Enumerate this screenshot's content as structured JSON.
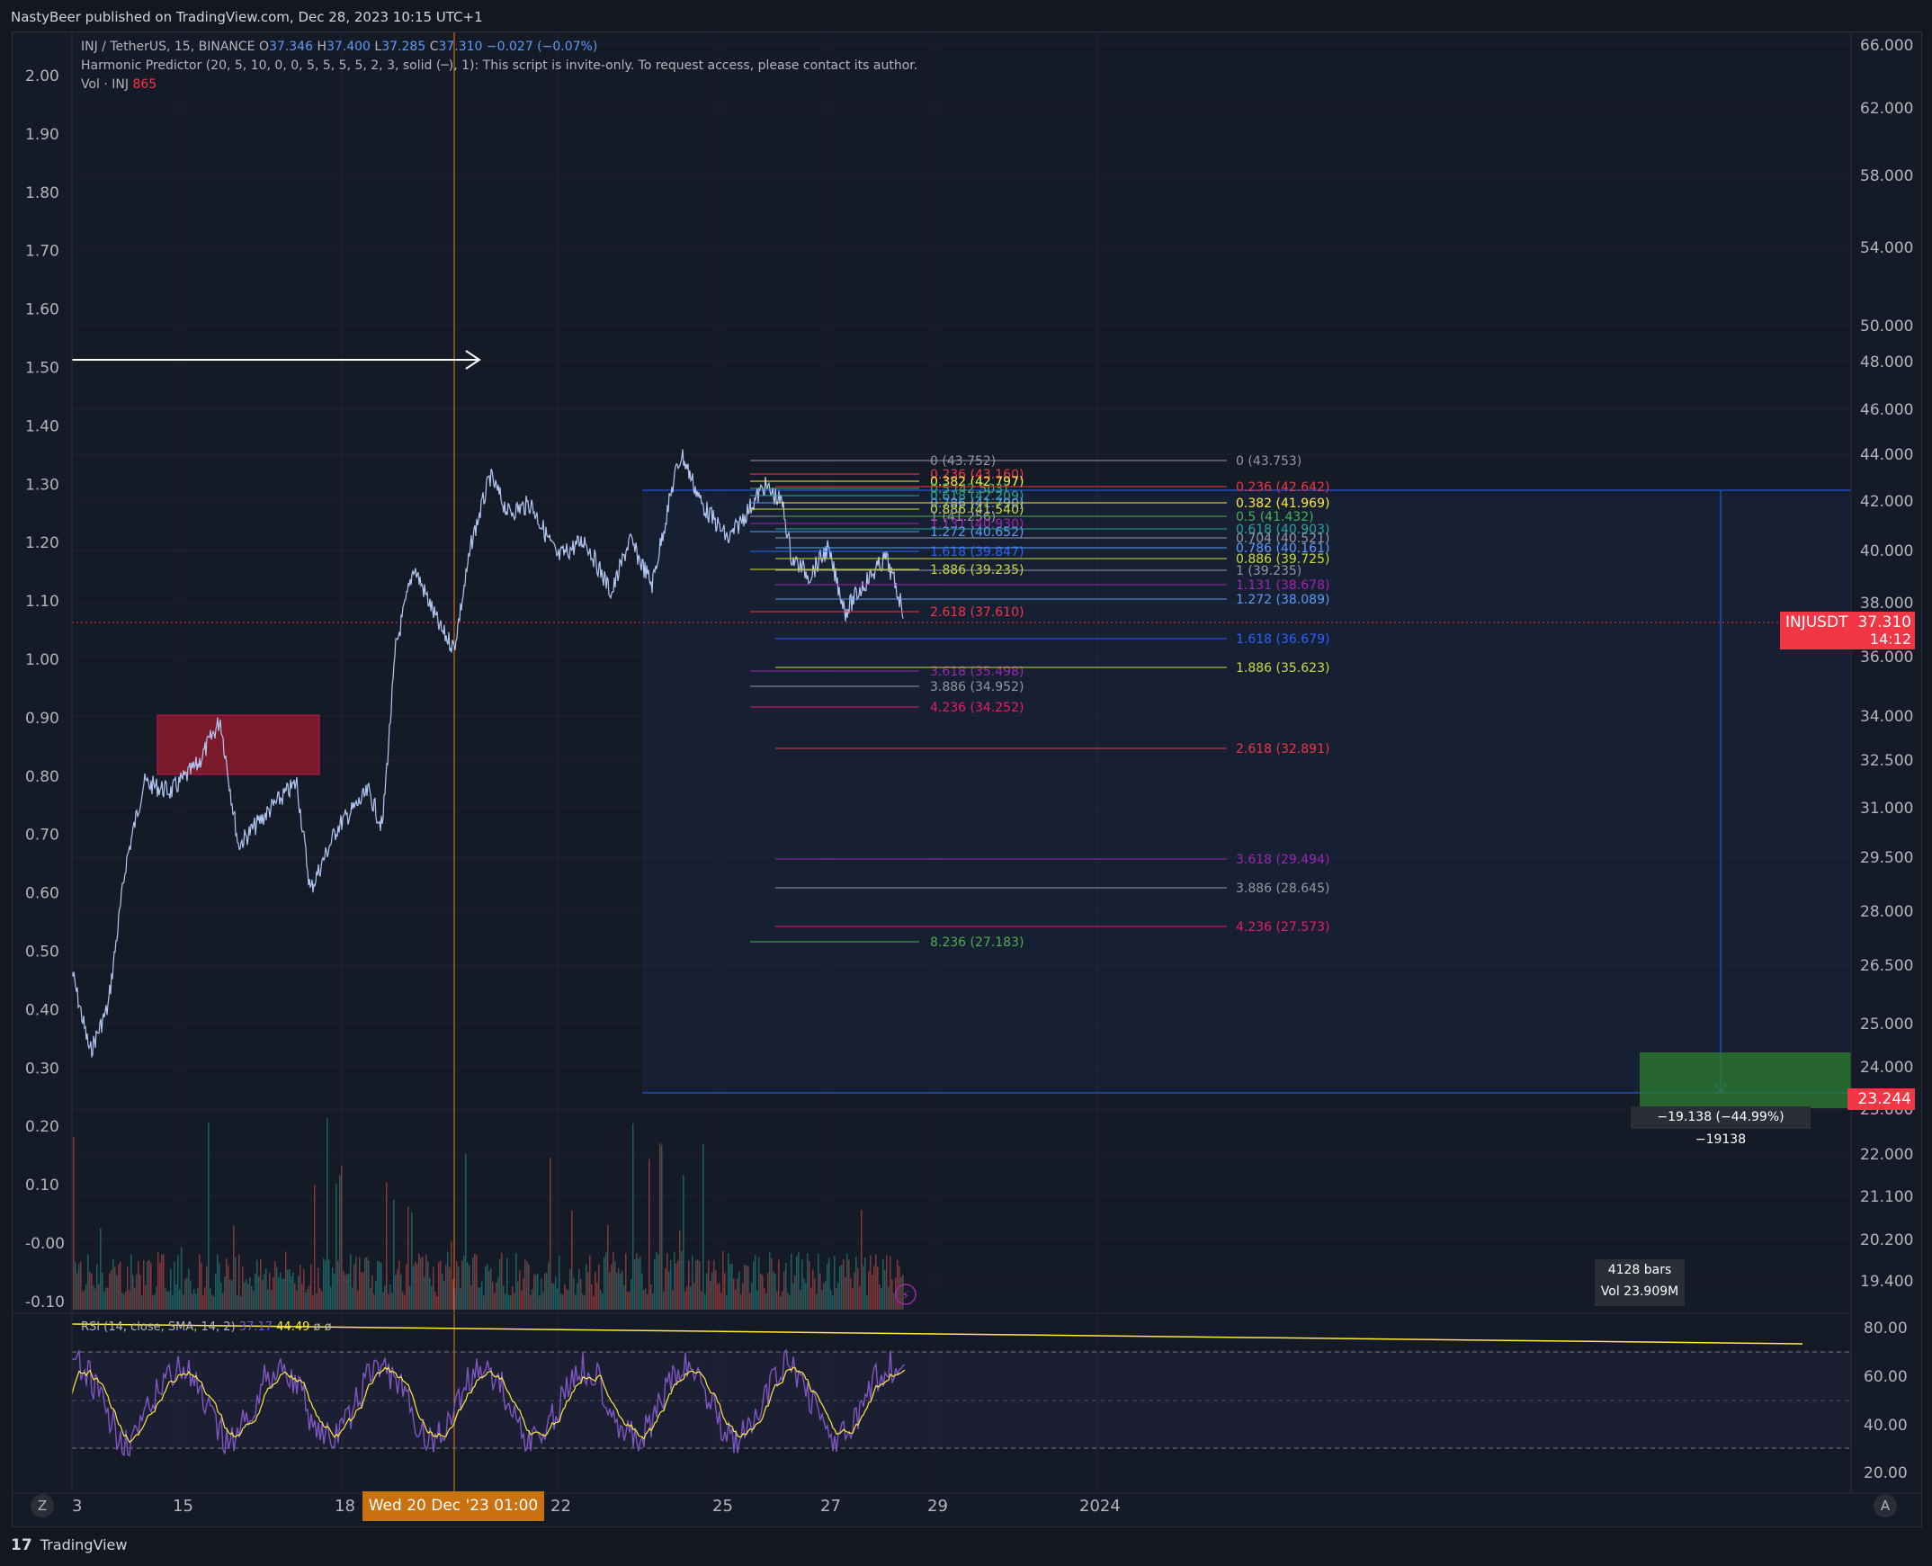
{
  "header": {
    "publisher_line": "NastyBeer published on TradingView.com, Dec 28, 2023 10:15 UTC+1"
  },
  "legend": {
    "symbol_line_prefix": "INJ / TetherUS, 15, BINANCE",
    "open_label": "O",
    "open": "37.346",
    "high_label": "H",
    "high": "37.400",
    "low_label": "L",
    "low": "37.285",
    "close_label": "C",
    "close": "37.310",
    "change": "−0.027 (−0.07%)",
    "indicator_line": "Harmonic Predictor (20, 5, 10, 0, 0, 5, 5, 5, 5, 2, 3, solid (─), 1): This script is invite-only. To request access, please contact its author.",
    "vol_label": "Vol · INJ",
    "vol_value": "865"
  },
  "rsi_legend": {
    "label": "RSI (14, close, SMA, 14, 2)",
    "rsi_value": "37.17",
    "sma_value": "44.49",
    "extra1": "ø",
    "extra2": "ø"
  },
  "left_axis": [
    "2.00",
    "1.90",
    "1.80",
    "1.70",
    "1.60",
    "1.50",
    "1.40",
    "1.30",
    "1.20",
    "1.10",
    "1.00",
    "0.90",
    "0.80",
    "0.70",
    "0.60",
    "0.50",
    "0.40",
    "0.30",
    "0.20",
    "0.10",
    "-0.00",
    "-0.10"
  ],
  "right_axis": [
    "66.000",
    "62.000",
    "58.000",
    "54.000",
    "50.000",
    "48.000",
    "46.000",
    "44.000",
    "42.000",
    "40.000",
    "38.000",
    "36.000",
    "34.000",
    "32.500",
    "31.000",
    "29.500",
    "28.000",
    "26.500",
    "25.000",
    "24.000",
    "23.000",
    "22.000",
    "21.100",
    "20.200",
    "19.400"
  ],
  "rsi_axis": [
    "80.00",
    "60.00",
    "40.00",
    "20.00"
  ],
  "x_axis": {
    "labels": [
      "3",
      "15",
      "18",
      "22",
      "25",
      "27",
      "29",
      "2024"
    ],
    "highlight": "Wed 20 Dec '23   01:00",
    "z_button": "Z",
    "a_button": "A"
  },
  "price_tag": {
    "symbol": "INJUSDT",
    "price": "37.310",
    "countdown": "14:12"
  },
  "target_tag": "23.244",
  "measure_label": "−19.138 (−44.99%) −19138",
  "bars_box": {
    "bars": "4128 bars",
    "vol": "Vol 23.909M"
  },
  "fib_left": [
    {
      "text": "0 (43.752)",
      "color": "#9598a1"
    },
    {
      "text": "0.236 (43.160)",
      "color": "#f23645"
    },
    {
      "text": "0.382 (42.797)",
      "color": "#ffeb3b"
    },
    {
      "text": "0.5 (42.503)",
      "color": "#4caf50"
    },
    {
      "text": "0.618 (42.209)",
      "color": "#26a69a"
    },
    {
      "text": "0.786 (41.790)",
      "color": "#5b9cf6"
    },
    {
      "text": "0.886 (41.540)",
      "color": "#cddc39"
    },
    {
      "text": "1 (41.256)",
      "color": "#9598a1"
    },
    {
      "text": "1.131 (40.930)",
      "color": "#9c27b0"
    },
    {
      "text": "1.272 (40.652)",
      "color": "#5b9cf6"
    },
    {
      "text": "1.618 (39.847)",
      "color": "#2962ff"
    },
    {
      "text": "1.886 (39.235)",
      "color": "#cddc39"
    },
    {
      "text": "2.618 (37.610)",
      "color": "#f23645"
    },
    {
      "text": "3.618 (35.498)",
      "color": "#9c27b0"
    },
    {
      "text": "3.886 (34.952)",
      "color": "#9598a1"
    },
    {
      "text": "4.236 (34.252)",
      "color": "#e91e63"
    },
    {
      "text": "8.236 (27.183)",
      "color": "#4caf50"
    }
  ],
  "fib_right": [
    {
      "text": "0 (43.753)",
      "color": "#9598a1"
    },
    {
      "text": "0.236 (42.642)",
      "color": "#f23645"
    },
    {
      "text": "0.382 (41.969)",
      "color": "#ffeb3b"
    },
    {
      "text": "0.5 (41.432)",
      "color": "#4caf50"
    },
    {
      "text": "0.618 (40.903)",
      "color": "#26a69a"
    },
    {
      "text": "0.704 (40.521)",
      "color": "#9598a1"
    },
    {
      "text": "0.786 (40.161)",
      "color": "#5b9cf6"
    },
    {
      "text": "0.886 (39.725)",
      "color": "#cddc39"
    },
    {
      "text": "1 (39.235)",
      "color": "#9598a1"
    },
    {
      "text": "1.131 (38.678)",
      "color": "#9c27b0"
    },
    {
      "text": "1.272 (38.089)",
      "color": "#5b9cf6"
    },
    {
      "text": "1.618 (36.679)",
      "color": "#2962ff"
    },
    {
      "text": "1.886 (35.623)",
      "color": "#cddc39"
    },
    {
      "text": "2.618 (32.891)",
      "color": "#f23645"
    },
    {
      "text": "3.618 (29.494)",
      "color": "#9c27b0"
    },
    {
      "text": "3.886 (28.645)",
      "color": "#9598a1"
    },
    {
      "text": "4.236 (27.573)",
      "color": "#e91e63"
    }
  ],
  "footer": {
    "logo": "17",
    "brand": "TradingView"
  },
  "colors": {
    "background": "#131722",
    "price_line": "#b2c6f2",
    "volume_up": "#26a69a",
    "volume_down": "#ef5350",
    "rsi": "#7e57c2",
    "rsi_sma": "#ffeb3b",
    "target_zone": "#2e7d32",
    "supply_zone": "#8b1a2b"
  }
}
